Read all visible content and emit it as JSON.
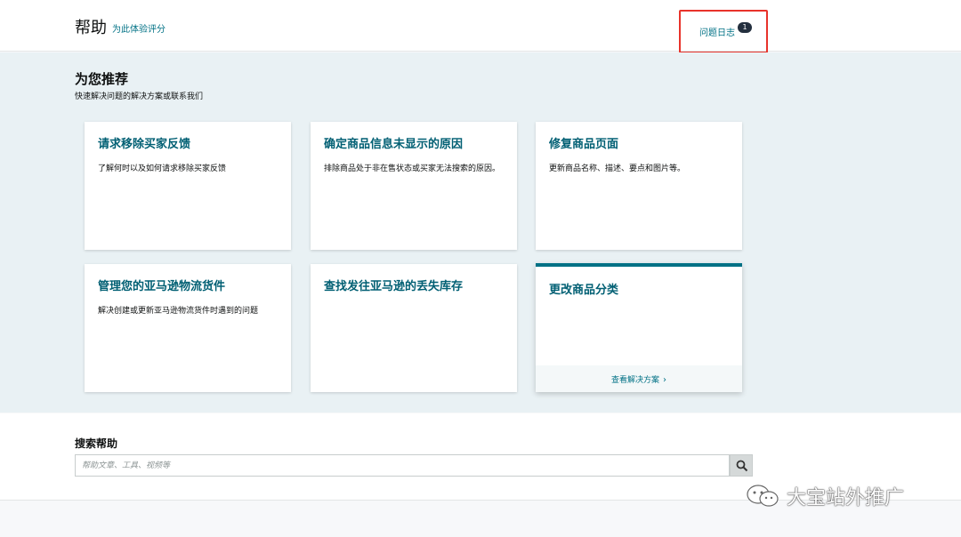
{
  "header": {
    "title": "帮助",
    "rate_link": "为此体验评分",
    "log_link": "问题日志",
    "log_count": "1"
  },
  "recommend": {
    "title": "为您推荐",
    "subtitle": "快速解决问题的解决方案或联系我们",
    "cards": [
      {
        "title": "请求移除买家反馈",
        "desc": "了解何时以及如何请求移除买家反馈"
      },
      {
        "title": "确定商品信息未显示的原因",
        "desc": "排除商品处于非在售状态或买家无法搜索的原因。"
      },
      {
        "title": "修复商品页面",
        "desc": "更新商品名称、描述、要点和图片等。"
      },
      {
        "title": "管理您的亚马逊物流货件",
        "desc": "解决创建或更新亚马逊物流货件时遇到的问题"
      },
      {
        "title": "查找发往亚马逊的丢失库存",
        "desc": ""
      },
      {
        "title": "更改商品分类",
        "desc": "",
        "link": "查看解决方案"
      }
    ]
  },
  "search": {
    "title": "搜索帮助",
    "placeholder": "帮助文章、工具、视频等"
  },
  "watermark": {
    "text": "大宝站外推广"
  },
  "colors": {
    "accent": "#007185",
    "card_title": "#005f73",
    "annotation": "#e8332b",
    "section_bg": "#e9f1f4"
  }
}
